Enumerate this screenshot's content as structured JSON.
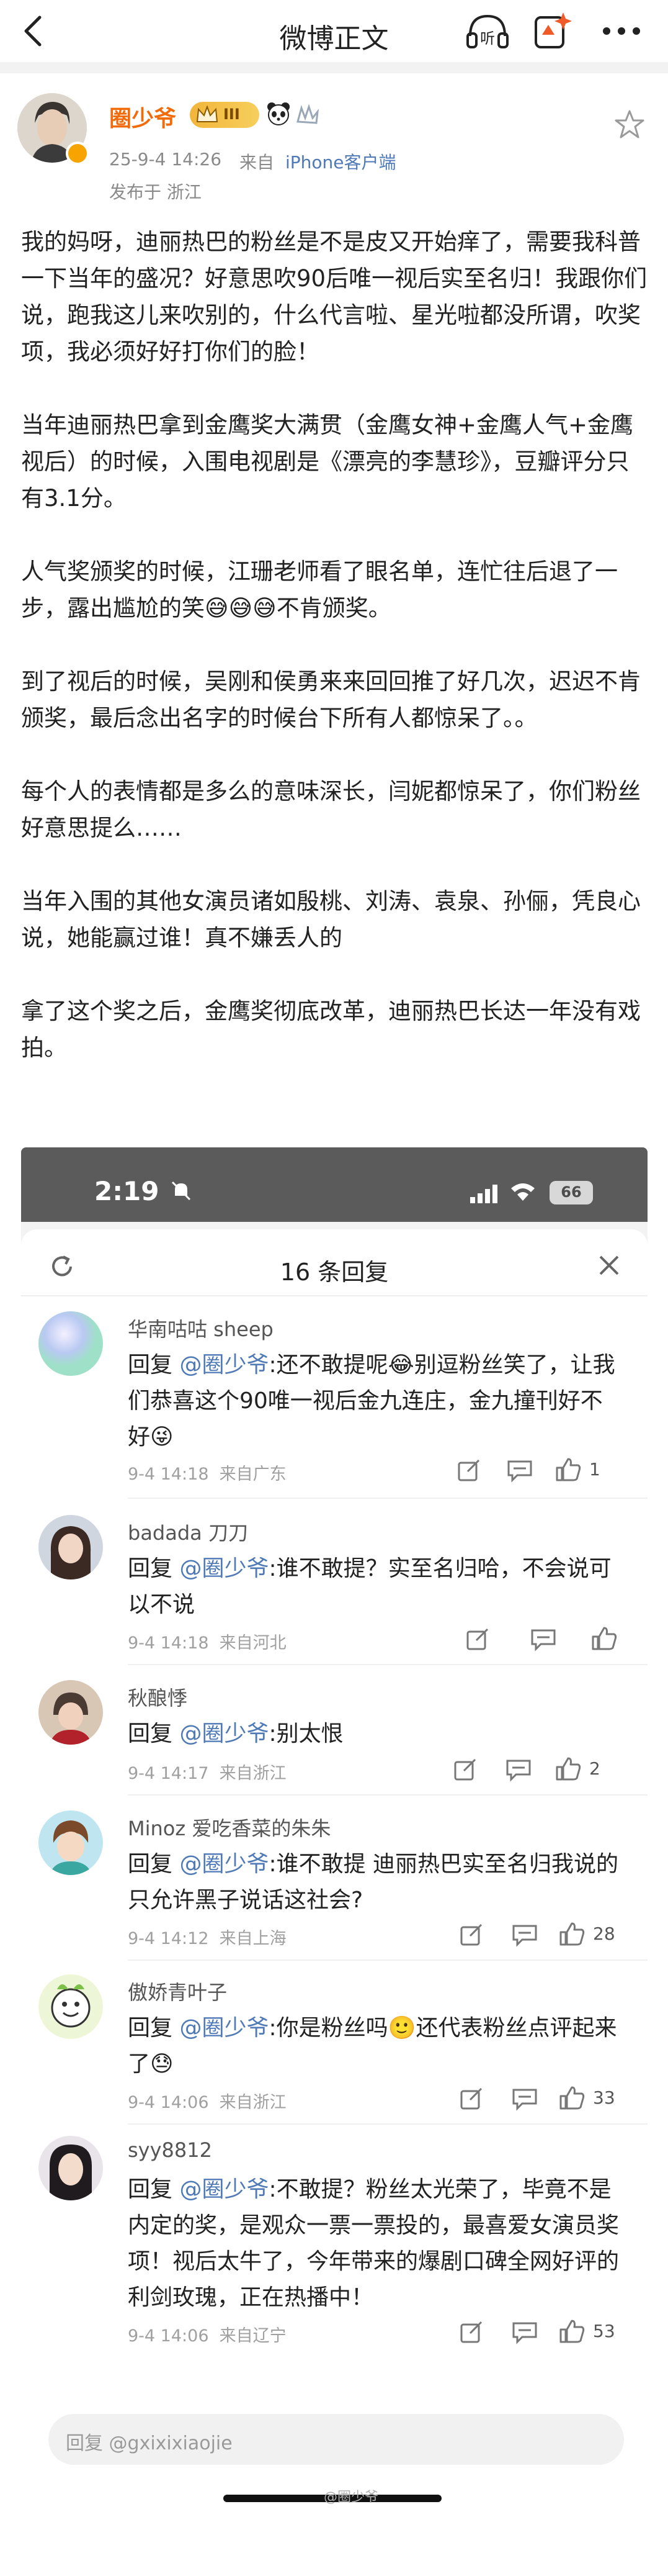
{
  "nav": {
    "title": "微博正文",
    "listen_label": "听"
  },
  "post": {
    "author": "圈少爷",
    "level": "III",
    "date": "25-9-4 14:26",
    "source_prefix": "来自",
    "device": "iPhone客户端",
    "location": "发布于 浙江",
    "paragraphs": [
      "我的妈呀，迪丽热巴的粉丝是不是皮又开始痒了，需要我科普一下当年的盛况？好意思吹90后唯一视后实至名归！我跟你们说，跑我这儿来吹别的，什么代言啦、星光啦都没所谓，吹奖项，我必须好好打你们的脸！",
      "当年迪丽热巴拿到金鹰奖大满贯（金鹰女神+金鹰人气+金鹰视后）的时候，入围电视剧是《漂亮的李慧珍》，豆瓣评分只有3.1分。",
      "人气奖颁奖的时候，江珊老师看了眼名单，连忙往后退了一步，露出尴尬的笑😅😅😅不肯颁奖。",
      "到了视后的时候，吴刚和侯勇来来回回推了好几次，迟迟不肯颁奖，最后念出名字的时候台下所有人都惊呆了。。",
      "每个人的表情都是多么的意味深长，闫妮都惊呆了，你们粉丝好意思提么……",
      "当年入围的其他女演员诸如殷桃、刘涛、袁泉、孙俪，凭良心说，她能赢过谁！真不嫌丢人的",
      "拿了这个奖之后，金鹰奖彻底改革，迪丽热巴长达一年没有戏拍。"
    ]
  },
  "screenshot": {
    "status_time": "2:19",
    "battery": "66",
    "sheet_title": "16 条回复",
    "reply_prefix": "回复",
    "mention": "@圈少爷",
    "input_placeholder": "回复 @gxixixiaojie",
    "replies": [
      {
        "name": "华南咕咕 sheep",
        "text": ":还不敢提呢😂别逗粉丝笑了，让我们恭喜这个90唯一视后金九连庄，金九撞刊好不好😜",
        "time": "9-4 14:18",
        "from": "来自广东",
        "likes": "1"
      },
      {
        "name": "badada 刀刀",
        "text": ":谁不敢提？实至名归哈，不会说可以不说",
        "time": "9-4 14:18",
        "from": "来自河北",
        "likes": ""
      },
      {
        "name": "秋酿悸",
        "text": ":别太恨",
        "time": "9-4 14:17",
        "from": "来自浙江",
        "likes": "2"
      },
      {
        "name": "Minoz 爱吃香菜的朱朱",
        "text": ":谁不敢提 迪丽热巴实至名归我说的 只允许黑子说话这社会?",
        "time": "9-4 14:12",
        "from": "来自上海",
        "likes": "28"
      },
      {
        "name": "傲娇青叶子",
        "text": ":你是粉丝吗🙂还代表粉丝点评起来了😓",
        "time": "9-4 14:06",
        "from": "来自浙江",
        "likes": "33"
      },
      {
        "name": "syy8812",
        "text": ":不敢提？粉丝太光荣了，毕竟不是内定的奖，是观众一票一票投的，最喜爱女演员奖项！视后太牛了，今年带来的爆剧口碑全网好评的利剑玫瑰，正在热播中！",
        "time": "9-4 14:06",
        "from": "来自辽宁",
        "likes": "53"
      }
    ]
  },
  "watermark": "@圈少爷",
  "colors": {
    "author_orange": "#f26b0b",
    "link_blue": "#4f7ab6",
    "meta_gray": "#8a8a8a"
  }
}
